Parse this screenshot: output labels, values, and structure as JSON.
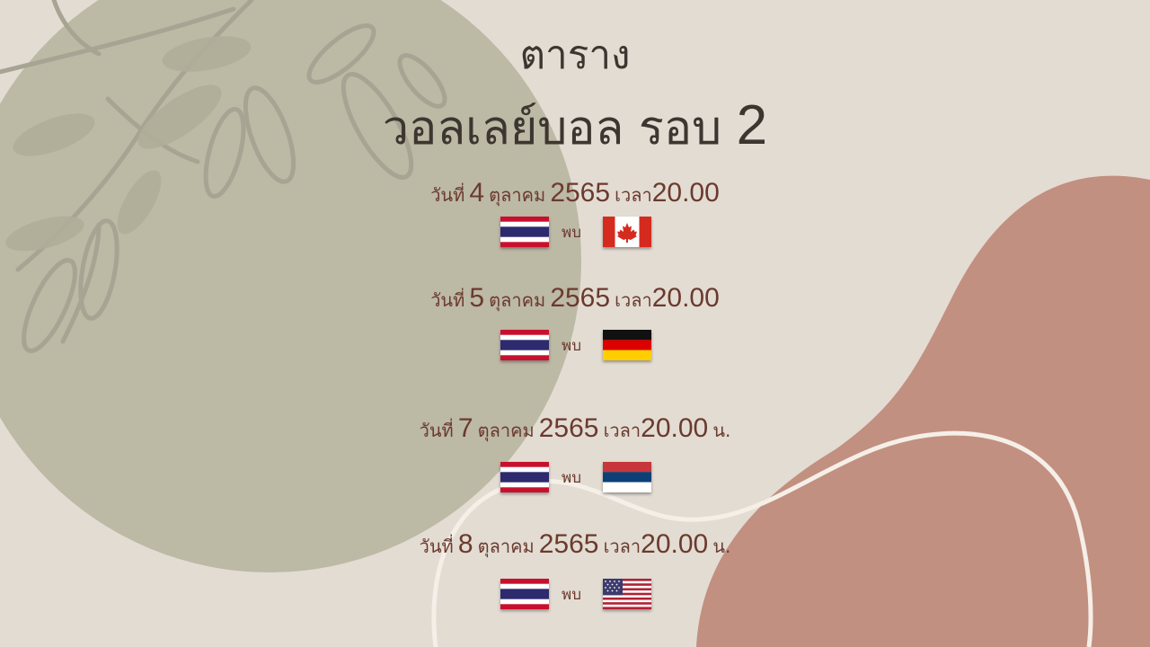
{
  "title": {
    "line1": "ตาราง",
    "line2_text": "วอลเลย์บอล รอบ",
    "line2_number": "2"
  },
  "labels": {
    "day": "วันที่",
    "time": "เวลา",
    "versus": "พบ"
  },
  "matches": [
    {
      "day_number": "4",
      "month": "ตุลาคม",
      "year": "2565",
      "time": "20.00",
      "suffix": "",
      "home_flag": "thailand-flag",
      "away_flag": "canada-flag"
    },
    {
      "day_number": "5",
      "month": "ตุลาคม",
      "year": "2565",
      "time": "20.00",
      "suffix": "",
      "home_flag": "thailand-flag",
      "away_flag": "germany-flag"
    },
    {
      "day_number": "7",
      "month": "ตุลาคม",
      "year": "2565",
      "time": "20.00",
      "suffix": "น.",
      "home_flag": "thailand-flag",
      "away_flag": "serbia-flag"
    },
    {
      "day_number": "8",
      "month": "ตุลาคม",
      "year": "2565",
      "time": "20.00",
      "suffix": "น.",
      "home_flag": "thailand-flag",
      "away_flag": "usa-flag"
    }
  ],
  "colors": {
    "background": "#e3dcd3",
    "olive_circle": "#bcb9a5",
    "terracotta_blob": "#c29080",
    "title_text": "#3d3630",
    "match_text": "#6b3a2e"
  }
}
